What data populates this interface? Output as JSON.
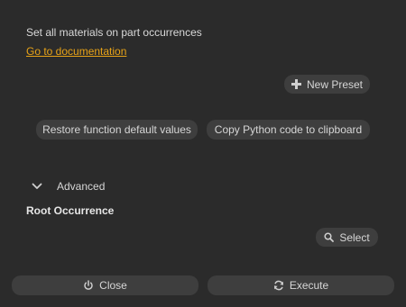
{
  "description": "Set all materials on part occurrences",
  "documentation_link": "Go to documentation",
  "presets": {
    "new_preset_label": "New Preset",
    "new_preset_icon": "plus-icon"
  },
  "actions": {
    "restore_defaults_label": "Restore function default values",
    "copy_python_label": "Copy Python code to clipboard"
  },
  "advanced": {
    "label": "Advanced",
    "expanded": true,
    "toggle_icon": "chevron-down-icon"
  },
  "root_occurrence": {
    "title": "Root Occurrence",
    "select_label": "Select",
    "select_icon": "search-icon"
  },
  "footer": {
    "close_label": "Close",
    "close_icon": "power-icon",
    "execute_label": "Execute",
    "execute_icon": "refresh-icon"
  },
  "colors": {
    "background": "#2b2b2b",
    "button": "#3e3e3e",
    "text": "#d6d6d6",
    "link": "#e8a317"
  }
}
